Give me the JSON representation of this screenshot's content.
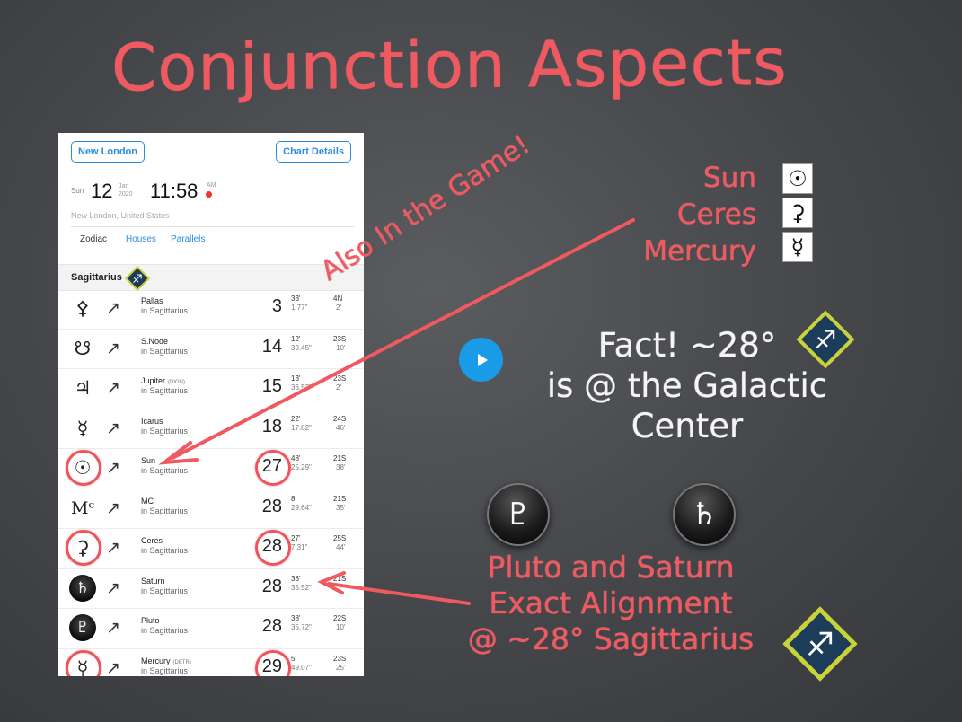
{
  "slide": {
    "title": "Conjunction Aspects",
    "diagonal_note": "Also In the Game!",
    "planets_header": [
      "Sun",
      "Ceres",
      "Mercury"
    ],
    "planet_symbols": [
      "sun-icon",
      "ceres-icon",
      "mercury-icon"
    ],
    "fact_lines": [
      "Fact! ~28°",
      "is @ the Galactic",
      "Center"
    ],
    "alignment_lines": [
      "Pluto and Saturn",
      "Exact Alignment",
      "@ ~28° Sagittarius"
    ],
    "accent_color": "#f0595f"
  },
  "app": {
    "location_button": "New London",
    "chart_details_button": "Chart Details",
    "date": {
      "weekday": "Sun",
      "day": "12",
      "month": "Jan",
      "year": "2020",
      "time": "11:58",
      "ampm": "AM"
    },
    "place": "New London, United States",
    "tabs": [
      "Zodiac",
      "Houses",
      "Parallels"
    ],
    "section": "Sagittarius",
    "rows": [
      {
        "glyph": "⚴",
        "name": "Pallas",
        "tag": "",
        "sign": "in Sagittarius",
        "deg": "3",
        "min": "33'",
        "sec": "1.77\"",
        "dec": "4N",
        "decmin": "2'"
      },
      {
        "glyph": "☋",
        "name": "S.Node",
        "tag": "",
        "sign": "in Sagittarius",
        "deg": "14",
        "min": "12'",
        "sec": "39.45\"",
        "dec": "23S",
        "decmin": "10'"
      },
      {
        "glyph": "♃",
        "name": "Jupiter",
        "tag": "(DIGN)",
        "sign": "in Sagittarius",
        "deg": "15",
        "min": "13'",
        "sec": "36.53\"",
        "dec": "23S",
        "decmin": "2'"
      },
      {
        "glyph": "☿",
        "name": "Icarus",
        "tag": "",
        "sign": "in Sagittarius",
        "deg": "18",
        "min": "22'",
        "sec": "17.82\"",
        "dec": "24S",
        "decmin": "46'"
      },
      {
        "glyph": "☉",
        "name": "Sun",
        "tag": "",
        "sign": "in Sagittarius",
        "deg": "27",
        "min": "48'",
        "sec": "25.29\"",
        "dec": "21S",
        "decmin": "38'"
      },
      {
        "glyph": "Mᶜ",
        "name": "MC",
        "tag": "",
        "sign": "in Sagittarius",
        "deg": "28",
        "min": "8'",
        "sec": "29.64\"",
        "dec": "21S",
        "decmin": "35'"
      },
      {
        "glyph": "⚳",
        "name": "Ceres",
        "tag": "",
        "sign": "in Sagittarius",
        "deg": "28",
        "min": "27'",
        "sec": "7.31\"",
        "dec": "25S",
        "decmin": "44'"
      },
      {
        "glyph": "♄",
        "name": "Saturn",
        "tag": "",
        "sign": "in Sagittarius",
        "deg": "28",
        "min": "38'",
        "sec": "35.52\"",
        "dec": "21S",
        "decmin": ""
      },
      {
        "glyph": "♇",
        "name": "Pluto",
        "tag": "",
        "sign": "in Sagittarius",
        "deg": "28",
        "min": "38'",
        "sec": "35.72\"",
        "dec": "22S",
        "decmin": "10'"
      },
      {
        "glyph": "☿",
        "name": "Mercury",
        "tag": "(DETR)",
        "sign": "in Sagittarius",
        "deg": "29",
        "min": "5'",
        "sec": "49.07\"",
        "dec": "23S",
        "decmin": "25'"
      }
    ]
  },
  "icons": {
    "pluto": "♇",
    "saturn": "♄",
    "sagittarius": "♐",
    "sun": "☉",
    "ceres": "⚳",
    "mercury": "☿",
    "play": "play-icon"
  }
}
